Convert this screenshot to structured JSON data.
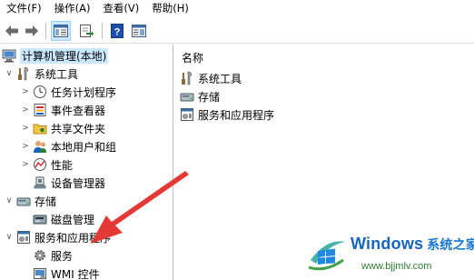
{
  "menubar": {
    "items": [
      "文件(F)",
      "操作(A)",
      "查看(V)",
      "帮助(H)"
    ]
  },
  "toolbar": {
    "buttons": [
      "back-icon",
      "forward-icon",
      "show-hide-console-tree-icon",
      "export-list-icon",
      "help-icon",
      "action-pane-icon"
    ]
  },
  "tree": {
    "root": "计算机管理(本地)",
    "system_tools": {
      "label": "系统工具",
      "children": [
        "任务计划程序",
        "事件查看器",
        "共享文件夹",
        "本地用户和组",
        "性能",
        "设备管理器"
      ]
    },
    "storage": {
      "label": "存储",
      "children": [
        "磁盘管理"
      ]
    },
    "services_apps": {
      "label": "服务和应用程序",
      "children": [
        "服务",
        "WMI 控件"
      ]
    }
  },
  "list": {
    "header": "名称",
    "items": [
      "系统工具",
      "存储",
      "服务和应用程序"
    ]
  },
  "watermark": {
    "brand": "Windows",
    "brand_sub": "系统之家",
    "url": "www.bjjmlv.com"
  },
  "colors": {
    "selection": "#cce8ff",
    "arrow": "#e53935",
    "brand": "#1565c0",
    "url": "#2e7d32"
  }
}
